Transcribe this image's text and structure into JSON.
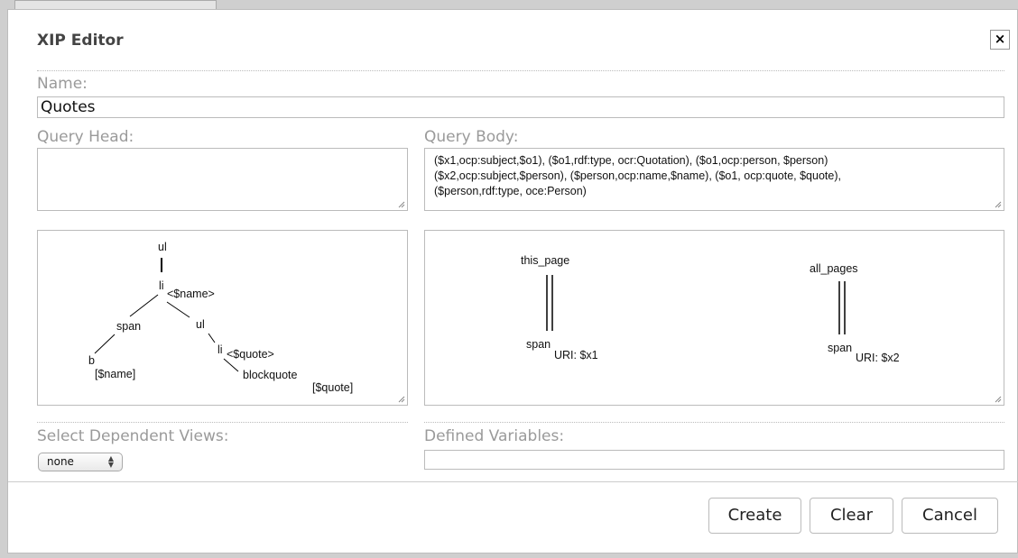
{
  "dialog": {
    "title": "XIP Editor",
    "close_symbol": "×"
  },
  "name": {
    "label": "Name:",
    "value": "Quotes"
  },
  "query_head": {
    "label": "Query Head:",
    "value": ""
  },
  "query_body": {
    "label": "Query Body:",
    "lines": [
      "($x1,ocp:subject,$o1), ($o1,rdf:type, ocr:Quotation), ($o1,ocp:person, $person)",
      "($x2,ocp:subject,$person), ($person,ocp:name,$name), ($o1, ocp:quote, $quote),",
      "($person,rdf:type, oce:Person)"
    ]
  },
  "tree_left": {
    "nodes": {
      "ul_root": "ul",
      "li_top": "li",
      "li_top_var": "<$name>",
      "span": "span",
      "ul_child": "ul",
      "b": "b",
      "b_var": "[$name]",
      "li_child": "li",
      "li_child_var": "<$quote>",
      "blockquote": "blockquote",
      "blockquote_var": "[$quote]"
    }
  },
  "tree_right": {
    "left": {
      "root": "this_page",
      "node": "span",
      "uri": "URI: $x1"
    },
    "right": {
      "root": "all_pages",
      "node": "span",
      "uri": "URI: $x2"
    }
  },
  "dependent_views": {
    "label": "Select Dependent Views:",
    "selected": "none",
    "arrows": "▲▼"
  },
  "defined_variables": {
    "label": "Defined Variables:",
    "value": ""
  },
  "buttons": {
    "create": "Create",
    "clear": "Clear",
    "cancel": "Cancel"
  }
}
